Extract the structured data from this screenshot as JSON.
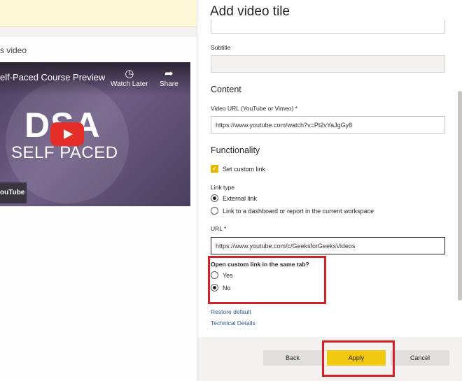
{
  "canvas": {
    "tile_title": "s video",
    "video": {
      "title": "elf-Paced Course Preview ...",
      "watch_later": "Watch Later",
      "share": "Share",
      "watch_later_icon": "clock-icon",
      "share_icon": "share-arrow-icon",
      "thumb_line1": "DSA",
      "thumb_line2": "SELF PACED",
      "yt_label": "ouTube"
    }
  },
  "panel": {
    "title": "Add video tile",
    "title_value": "",
    "subtitle_label": "Subtitle",
    "subtitle_value": "",
    "content_heading": "Content",
    "video_url_label": "Video URL (YouTube or Vimeo) *",
    "video_url_value": "https://www.youtube.com/watch?v=Pt2vYaJgGy8",
    "functionality_heading": "Functionality",
    "set_custom_link_label": "Set custom link",
    "set_custom_link_checked": true,
    "link_type_label": "Link type",
    "link_type_options": [
      "External link",
      "Link to a dashboard or report in the current workspace"
    ],
    "link_type_selected": "External link",
    "url_label": "URL *",
    "url_value": "https://www.youtube.com/c/GeeksforGeeksVideos",
    "same_tab_label": "Open custom link in the same tab?",
    "same_tab_options": [
      "Yes",
      "No"
    ],
    "same_tab_selected": "No",
    "restore_default": "Restore default",
    "technical_details": "Technical Details"
  },
  "footer": {
    "back": "Back",
    "apply": "Apply",
    "cancel": "Cancel"
  },
  "colors": {
    "accent_yellow": "#f2c811",
    "highlight_red": "#d42027",
    "link_blue": "#2b5797"
  }
}
